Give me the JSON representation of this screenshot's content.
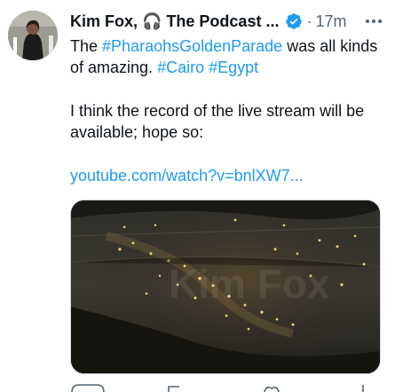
{
  "tweet": {
    "author_name": "Kim Fox, 🎧 The Podcast ...",
    "separator": "·",
    "time": "17m",
    "line1_pre": "The ",
    "tag1": "#PharaohsGoldenParade",
    "line1_post": " was all kinds of amazing. ",
    "tag2": "#Cairo",
    "space": " ",
    "tag3": "#Egypt",
    "para2": "I think the record of the live stream will be available; hope so:",
    "link": "youtube.com/watch?v=bnlXW7..."
  },
  "colors": {
    "link": "#1d9bf0",
    "muted": "#536471",
    "verified": "#1d9bf0"
  },
  "icons": {
    "verified": "verified-badge-icon",
    "more": "more-options-icon"
  }
}
